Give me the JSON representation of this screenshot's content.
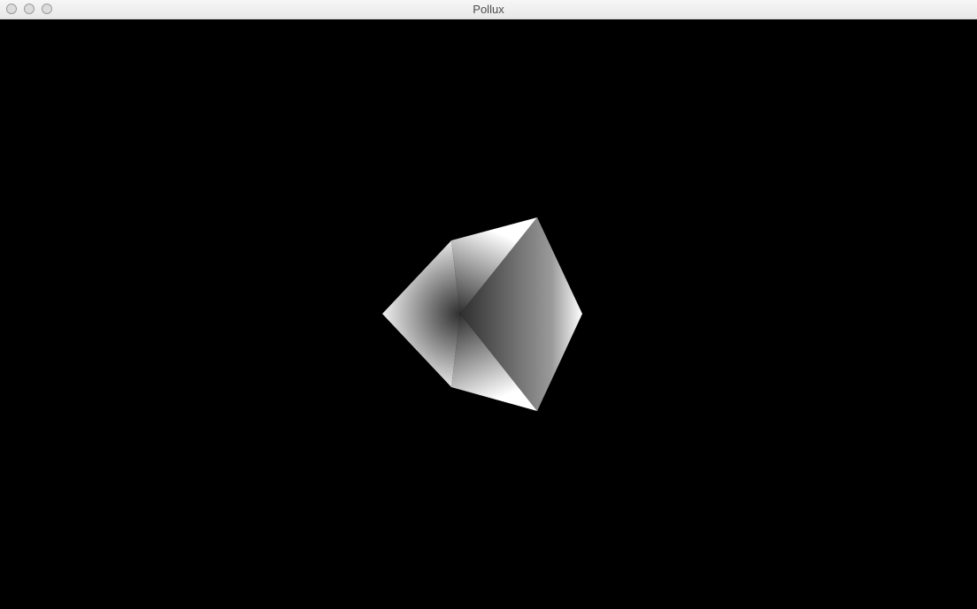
{
  "window": {
    "title": "Pollux",
    "controls": [
      "close",
      "minimize",
      "zoom"
    ]
  },
  "viewport": {
    "background": "#000000",
    "object": "shaded-cube",
    "colors": {
      "highlight": "#ffffff",
      "shadow": "#2f2f2f"
    }
  }
}
